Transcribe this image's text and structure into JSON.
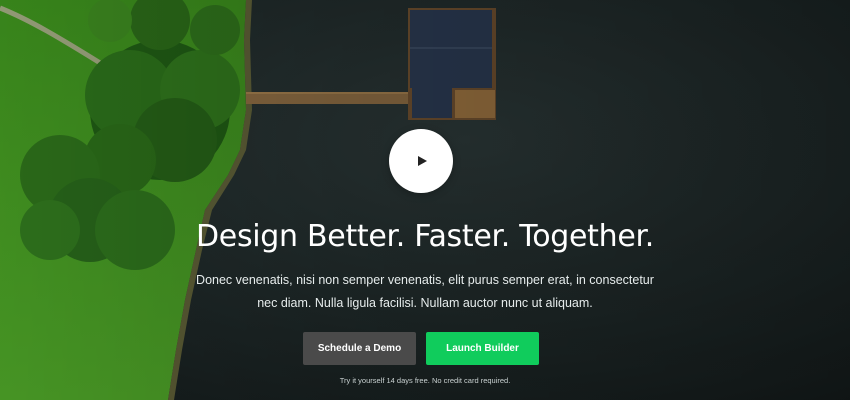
{
  "hero": {
    "headline": "Design Better. Faster. Together.",
    "subtext_line1": "Donec venenatis, nisi non semper venenatis, elit purus semper erat, in consectetur",
    "subtext_line2": "nec diam. Nulla ligula facilisi. Nullam auctor nunc ut aliquam.",
    "play_icon": "play-icon",
    "buttons": {
      "demo_label": "Schedule a Demo",
      "launch_label": "Launch Builder"
    },
    "trial_note": "Try it yourself 14 days free. No credit card required."
  },
  "colors": {
    "launch_button": "#10cc5c",
    "demo_button": "#4a4a4a",
    "water": "#1b2424",
    "grass": "#3f8f1f"
  }
}
